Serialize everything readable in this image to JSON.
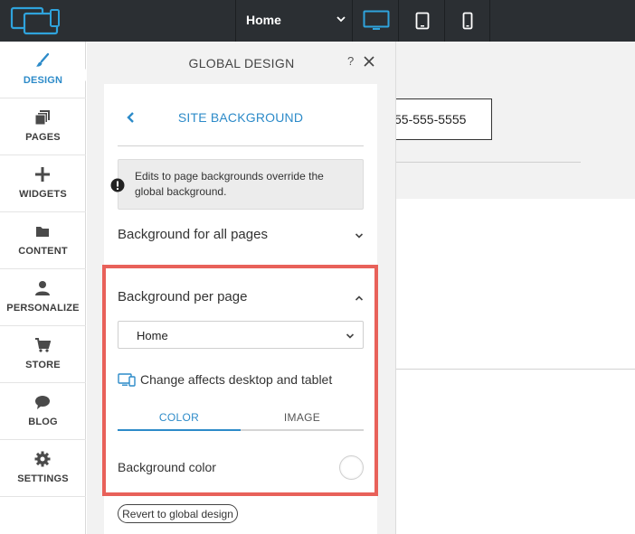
{
  "topbar": {
    "page_select_value": "Home",
    "devices": [
      "desktop",
      "tablet",
      "phone"
    ],
    "active_device": "desktop"
  },
  "nav": {
    "items": [
      {
        "label": "DESIGN",
        "icon": "paintbrush-icon",
        "active": true
      },
      {
        "label": "PAGES",
        "icon": "pages-icon"
      },
      {
        "label": "WIDGETS",
        "icon": "plus-icon"
      },
      {
        "label": "CONTENT",
        "icon": "folder-icon"
      },
      {
        "label": "PERSONALIZE",
        "icon": "person-icon"
      },
      {
        "label": "STORE",
        "icon": "cart-icon"
      },
      {
        "label": "BLOG",
        "icon": "speech-bubble-icon"
      },
      {
        "label": "SETTINGS",
        "icon": "gear-icon"
      }
    ]
  },
  "panel": {
    "title": "GLOBAL DESIGN",
    "help_label": "?",
    "section_title": "SITE BACKGROUND",
    "notice": "Edits to page backgrounds override the global background.",
    "background_all_label": "Background for all pages",
    "background_per_page_label": "Background per page",
    "page_dropdown_value": "Home",
    "affects_text": "Change affects desktop and tablet",
    "tabs": [
      "COLOR",
      "IMAGE"
    ],
    "active_tab": "COLOR",
    "background_color_label": "Background color",
    "revert_label": "Revert to global design"
  },
  "preview": {
    "phone_text": "55-555-5555"
  },
  "colors": {
    "accent": "#2d8bc9",
    "highlight": "#e8615a",
    "topbar": "#2b2f33"
  }
}
